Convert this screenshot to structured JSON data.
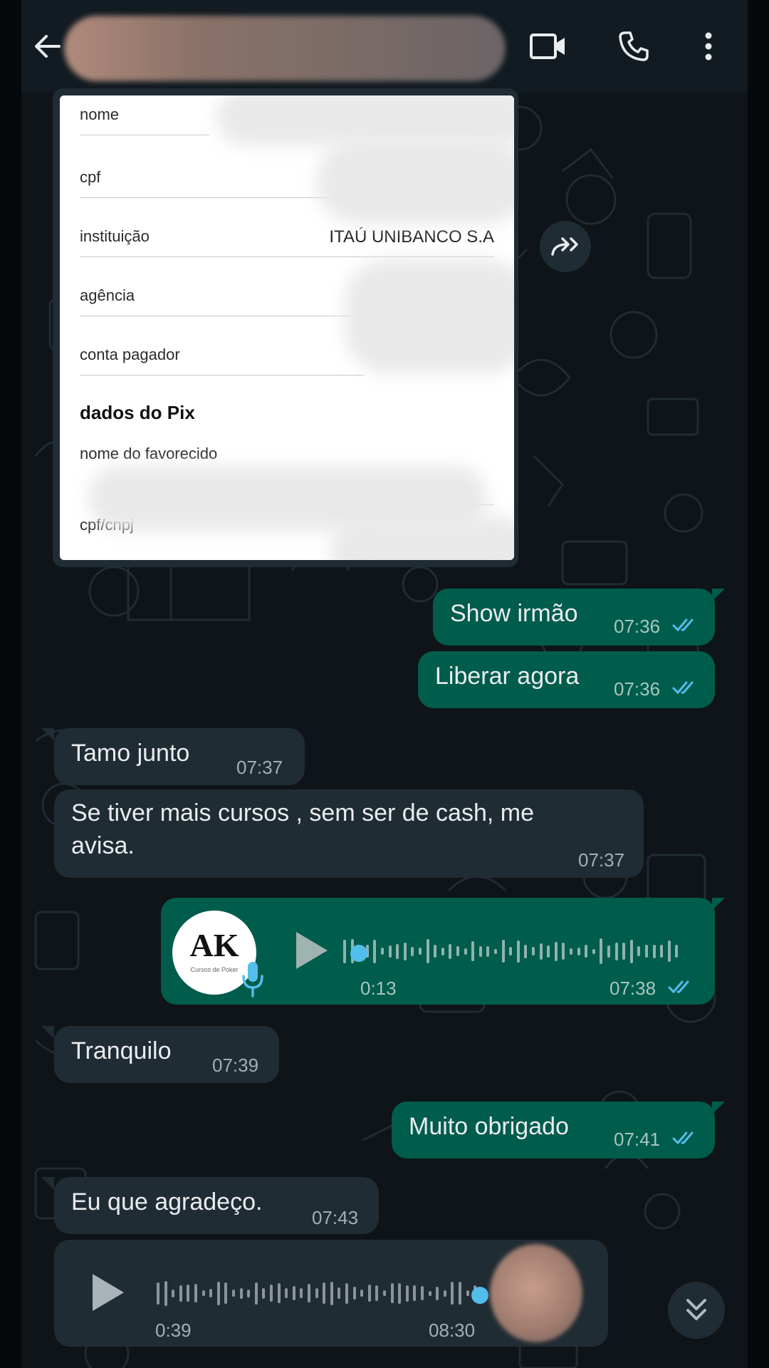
{
  "header": {
    "contact_name": "",
    "back_icon": "arrow-left-icon",
    "video_icon": "video-call-icon",
    "call_icon": "phone-icon",
    "menu_icon": "more-vertical-icon"
  },
  "receipt": {
    "rows": [
      {
        "label": "nome",
        "value": ""
      },
      {
        "label": "cpf",
        "value": ""
      },
      {
        "label": "instituição",
        "value": "ITAÚ UNIBANCO S.A"
      },
      {
        "label": "agência",
        "value": ""
      },
      {
        "label": "conta pagador",
        "value": ""
      }
    ],
    "section_title": "dados do Pix",
    "pix_rows": [
      {
        "label": "nome do favorecido",
        "value": ""
      },
      {
        "label": "cpf/cnpj",
        "value": ""
      }
    ]
  },
  "messages": [
    {
      "direction": "out",
      "text": "Show irmão",
      "time": "07:36",
      "status": "read"
    },
    {
      "direction": "out",
      "text": "Liberar agora",
      "time": "07:36",
      "status": "read"
    },
    {
      "direction": "in",
      "text": "Tamo junto",
      "time": "07:37"
    },
    {
      "direction": "in",
      "text_line1": "Se tiver mais cursos , sem ser de cash, me",
      "text_line2": "avisa.",
      "time": "07:37"
    },
    {
      "direction": "out",
      "type": "voice",
      "duration": "0:13",
      "time": "07:38",
      "status": "read",
      "avatar_logo_text": "AK",
      "avatar_logo_sub": "Cursos de Poker"
    },
    {
      "direction": "in",
      "text": "Tranquilo",
      "time": "07:39"
    },
    {
      "direction": "out",
      "text": "Muito obrigado",
      "time": "07:41",
      "status": "read"
    },
    {
      "direction": "in",
      "text": "Eu que agradeço.",
      "time": "07:43"
    },
    {
      "direction": "in",
      "type": "voice",
      "duration": "0:39",
      "time": "08:30"
    }
  ],
  "colors": {
    "outgoing_bubble": "#005c4b",
    "incoming_bubble": "#202c33",
    "read_ticks": "#53bdeb",
    "header_bg": "#111b21"
  },
  "icons": {
    "forward": "forward-icon",
    "play": "play-icon",
    "mic": "microphone-icon",
    "scroll_down": "double-chevron-down-icon"
  }
}
